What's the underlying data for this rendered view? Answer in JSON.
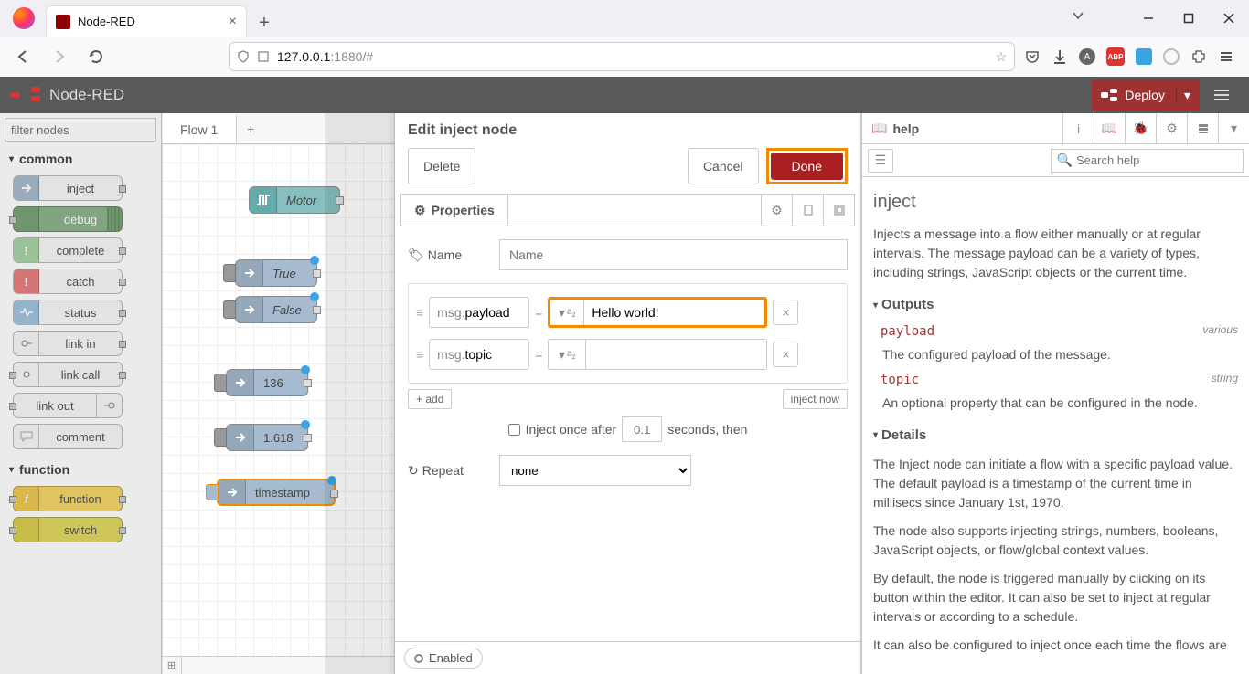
{
  "browser": {
    "tab_title": "Node-RED",
    "url_host": "127.0.0.1",
    "url_port": ":1880",
    "url_hash": "/#"
  },
  "header": {
    "title": "Node-RED",
    "deploy": "Deploy"
  },
  "palette": {
    "filter_placeholder": "filter nodes",
    "categories": {
      "common": "common",
      "function": "function"
    },
    "nodes": {
      "inject": "inject",
      "debug": "debug",
      "complete": "complete",
      "catch": "catch",
      "status": "status",
      "link_in": "link in",
      "link_call": "link call",
      "link_out": "link out",
      "comment": "comment",
      "function": "function",
      "switch": "switch"
    }
  },
  "workspace": {
    "tab": "Flow 1",
    "nodes": {
      "motor": "Motor",
      "true": "True",
      "false": "False",
      "n136": "136",
      "n1618": "1.618",
      "timestamp": "timestamp"
    }
  },
  "edit_tray": {
    "title": "Edit inject node",
    "delete": "Delete",
    "cancel": "Cancel",
    "done": "Done",
    "properties_tab": "Properties",
    "name_label": "Name",
    "name_placeholder": "Name",
    "props": [
      {
        "field": "payload",
        "value": "Hello world!"
      },
      {
        "field": "topic",
        "value": ""
      }
    ],
    "msg_prefix": "msg.",
    "add_btn": "+ add",
    "inject_now": "inject now",
    "inject_once_label": "Inject once after",
    "inject_once_value": "0.1",
    "inject_once_suffix": "seconds, then",
    "repeat_label": "Repeat",
    "repeat_value": "none",
    "enabled": "Enabled"
  },
  "sidebar": {
    "tab": "help",
    "search_placeholder": "Search help",
    "heading": "inject",
    "intro": "Injects a message into a flow either manually or at regular intervals. The message payload can be a variety of types, including strings, JavaScript objects or the current time.",
    "outputs_heading": "Outputs",
    "outputs": [
      {
        "key": "payload",
        "type": "various",
        "desc": "The configured payload of the message."
      },
      {
        "key": "topic",
        "type": "string",
        "desc": "An optional property that can be configured in the node."
      }
    ],
    "details_heading": "Details",
    "details_p1": "The Inject node can initiate a flow with a specific payload value. The default payload is a timestamp of the current time in millisecs since January 1st, 1970.",
    "details_p2": "The node also supports injecting strings, numbers, booleans, JavaScript objects, or flow/global context values.",
    "details_p3": "By default, the node is triggered manually by clicking on its button within the editor. It can also be set to inject at regular intervals or according to a schedule.",
    "details_p4": "It can also be configured to inject once each time the flows are"
  }
}
